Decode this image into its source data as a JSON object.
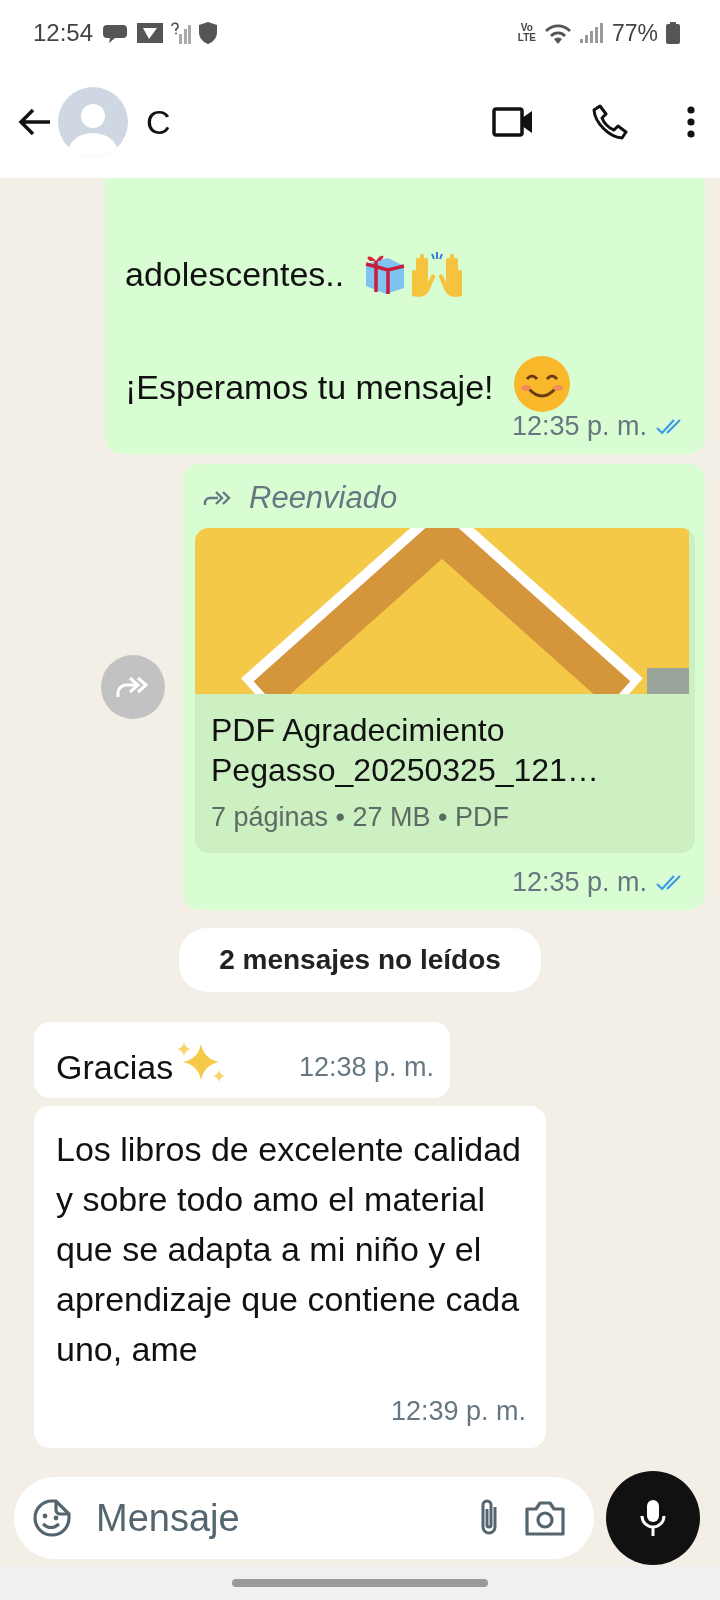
{
  "status_bar": {
    "time": "12:54",
    "network_label": "Vo\nLTE",
    "battery": "77%"
  },
  "header": {
    "contact_name": "C"
  },
  "messages": [
    {
      "kind": "text_out",
      "lines": [
        "adolescentes..",
        "¡Esperamos tu mensaje!"
      ],
      "time": "12:35 p. m.",
      "read": true
    },
    {
      "kind": "document",
      "forwarded_label": "Reenviado",
      "title": "PDF Agradecimiento Pegasso_20250325_121…",
      "meta": "7 páginas • 27 MB • PDF",
      "time": "12:35 p. m.",
      "read": true
    },
    {
      "kind": "divider",
      "text": "2 mensajes no leídos"
    },
    {
      "kind": "text_in",
      "text": "Gracias",
      "time": "12:38 p. m."
    },
    {
      "kind": "text_in",
      "text": "Los libros de excelente calidad y sobre todo amo el material que se adapta a mi niño y el aprendizaje que contiene cada uno, ame",
      "time": "12:39 p. m."
    }
  ],
  "composer": {
    "placeholder": "Mensaje"
  }
}
